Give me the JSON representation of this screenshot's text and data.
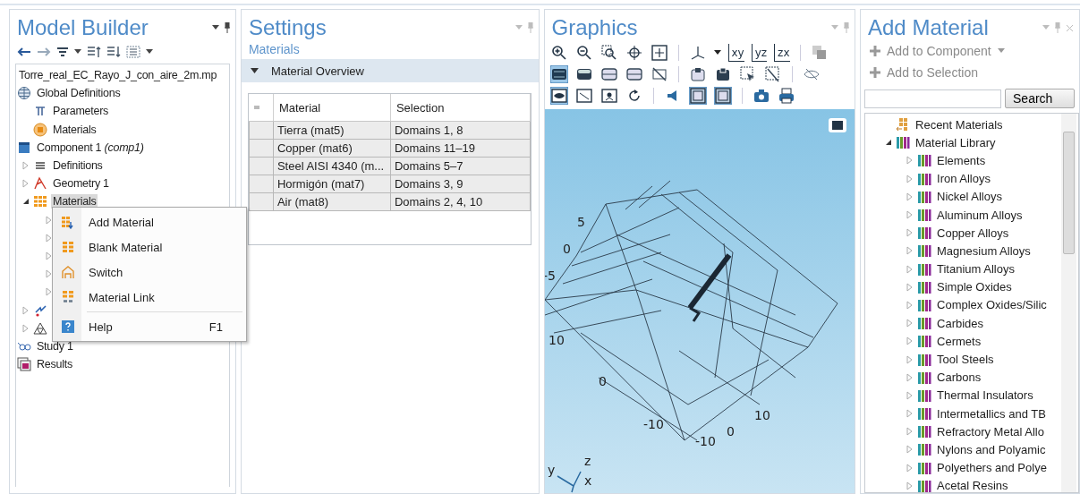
{
  "model_builder": {
    "title": "Model Builder",
    "tree": [
      {
        "label": "Torre_real_EC_Rayo_J_con_aire_2m.mp",
        "selected": false
      },
      {
        "label": "Global Definitions",
        "kind": "globe",
        "selected": false,
        "children": [
          {
            "label": "Parameters",
            "kind": "parameters",
            "selected": false
          },
          {
            "label": "Materials",
            "kind": "materials_global",
            "selected": false
          }
        ]
      },
      {
        "label": "Component 1 *(comp1)*",
        "kind": "component",
        "selected": false,
        "children": [
          {
            "label": "Definitions",
            "kind": "definitions",
            "expanded": false,
            "selected": false
          },
          {
            "label": "Geometry 1",
            "kind": "geometry",
            "expanded": false,
            "selected": false
          },
          {
            "label": "Materials",
            "kind": "materials",
            "expanded": true,
            "selected": true,
            "children": [
              {
                "expanded": false
              },
              {
                "expanded": false
              },
              {
                "expanded": false
              },
              {
                "expanded": false
              },
              {
                "expanded": false
              }
            ]
          },
          {
            "kind": "physics",
            "expanded": false
          },
          {
            "kind": "mesh",
            "expanded": false
          }
        ]
      },
      {
        "label": "Study 1",
        "kind": "study",
        "selected": false
      },
      {
        "label": "Results",
        "kind": "results",
        "selected": false
      }
    ]
  },
  "context_menu": {
    "items": [
      {
        "label": "Add Material",
        "kind": "add_material"
      },
      {
        "label": "Blank Material",
        "kind": "blank_material"
      },
      {
        "label": "Switch",
        "kind": "switch"
      },
      {
        "label": "Material Link",
        "kind": "material_link"
      },
      {
        "label": "Help",
        "kind": "help",
        "shortcut": "F1",
        "separator_before": true
      }
    ]
  },
  "settings": {
    "title": "Settings",
    "subtitle": "Materials",
    "section": {
      "label": "Material Overview",
      "expanded": true
    },
    "table": {
      "columns": [
        "Material",
        "Selection"
      ],
      "rows": [
        [
          "Tierra (mat5)",
          "Domains 1, 8"
        ],
        [
          "Copper (mat6)",
          "Domains 11–19"
        ],
        [
          "Steel AISI 4340 (m...",
          "Domains 5–7"
        ],
        [
          "Hormigón (mat7)",
          "Domains 3, 9"
        ],
        [
          "Air (mat8)",
          "Domains 2, 4, 10"
        ]
      ]
    }
  },
  "graphics": {
    "title": "Graphics",
    "toolbar": [
      [
        {
          "kind": "zoom_in",
          "pressed": false
        },
        {
          "kind": "zoom_out",
          "pressed": false
        },
        {
          "kind": "zoom_box",
          "pressed": false
        },
        {
          "kind": "center",
          "pressed": false
        },
        {
          "kind": "zoom_extents",
          "pressed": false
        },
        {
          "kind": "separator"
        },
        {
          "kind": "axes",
          "pressed": false
        },
        {
          "kind": "caret"
        },
        {
          "kind": "plane",
          "label": "xy",
          "pressed": false
        },
        {
          "kind": "plane",
          "label": "yz",
          "pressed": false
        },
        {
          "kind": "plane",
          "label": "zx",
          "pressed": false
        },
        {
          "kind": "separator"
        },
        {
          "kind": "layers",
          "pressed": false
        }
      ],
      [
        {
          "kind": "solid",
          "pressed": true
        },
        {
          "kind": "cylinder",
          "pressed": false
        },
        {
          "kind": "cylinder_outline",
          "pressed": false
        },
        {
          "kind": "cylinder_outline",
          "pressed": false
        },
        {
          "kind": "no_view",
          "pressed": false
        },
        {
          "kind": "separator"
        },
        {
          "kind": "select_box",
          "pressed": false
        },
        {
          "kind": "select_box_dark",
          "pressed": false
        },
        {
          "kind": "select_cursor",
          "pressed": false
        },
        {
          "kind": "select_cross",
          "pressed": false
        },
        {
          "kind": "separator"
        },
        {
          "kind": "hidden",
          "pressed": false
        }
      ],
      [
        {
          "kind": "window_eye",
          "pressed": true
        },
        {
          "kind": "window_hidden",
          "pressed": false
        },
        {
          "kind": "window_figure",
          "pressed": false
        },
        {
          "kind": "reset",
          "pressed": false
        },
        {
          "kind": "separator"
        },
        {
          "kind": "light",
          "pressed": false
        },
        {
          "kind": "frame",
          "pressed": true
        },
        {
          "kind": "frame",
          "pressed": true
        },
        {
          "kind": "separator"
        },
        {
          "kind": "camera",
          "pressed": false
        },
        {
          "kind": "printer",
          "pressed": false
        }
      ]
    ],
    "axis_labels": [
      "5",
      "0",
      "-5",
      "10",
      "0",
      "-10",
      "0",
      "10",
      "-10"
    ],
    "triad_labels": [
      "y",
      "z",
      "x"
    ]
  },
  "add_material": {
    "title": "Add Material",
    "actions": [
      {
        "label": "Add to Component",
        "disabled": true,
        "dropdown": true
      },
      {
        "label": "Add to Selection",
        "disabled": true
      }
    ],
    "search_button": "Search",
    "tree": [
      {
        "label": "Recent Materials",
        "kind": "recent"
      },
      {
        "label": "Material Library",
        "kind": "library",
        "expanded": true,
        "children": [
          {
            "label": "Elements",
            "kind": "library",
            "expanded": false
          },
          {
            "label": "Iron Alloys",
            "kind": "library",
            "expanded": false
          },
          {
            "label": "Nickel Alloys",
            "kind": "library",
            "expanded": false
          },
          {
            "label": "Aluminum Alloys",
            "kind": "library",
            "expanded": false
          },
          {
            "label": "Copper Alloys",
            "kind": "library",
            "expanded": false
          },
          {
            "label": "Magnesium Alloys",
            "kind": "library",
            "expanded": false
          },
          {
            "label": "Titanium Alloys",
            "kind": "library",
            "expanded": false
          },
          {
            "label": "Simple Oxides",
            "kind": "library",
            "expanded": false
          },
          {
            "label": "Complex Oxides/Silic",
            "kind": "library",
            "expanded": false
          },
          {
            "label": "Carbides",
            "kind": "library",
            "expanded": false
          },
          {
            "label": "Cermets",
            "kind": "library",
            "expanded": false
          },
          {
            "label": "Tool Steels",
            "kind": "library",
            "expanded": false
          },
          {
            "label": "Carbons",
            "kind": "library",
            "expanded": false
          },
          {
            "label": "Thermal Insulators",
            "kind": "library",
            "expanded": false
          },
          {
            "label": "Intermetallics and TB",
            "kind": "library",
            "expanded": false
          },
          {
            "label": "Refractory Metal Allo",
            "kind": "library",
            "expanded": false
          },
          {
            "label": "Nylons and Polyamic",
            "kind": "library",
            "expanded": false
          },
          {
            "label": "Polyethers and Polye",
            "kind": "library",
            "expanded": false
          },
          {
            "label": "Acetal Resins",
            "kind": "library",
            "expanded": false
          }
        ]
      }
    ]
  }
}
